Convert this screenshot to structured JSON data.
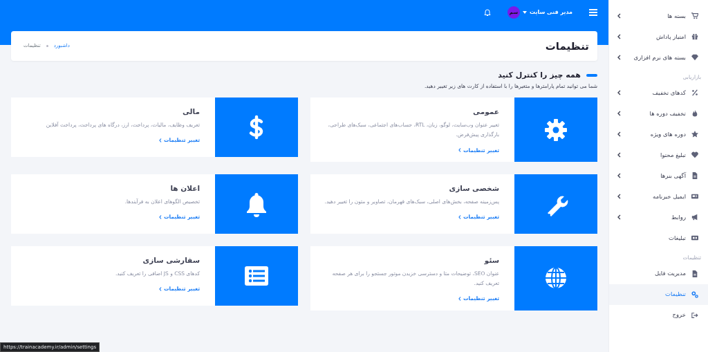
{
  "sidebar": {
    "items": [
      {
        "kind": "item",
        "label": "بسته ها",
        "has_children": true,
        "selected": false
      },
      {
        "kind": "item",
        "label": "امتیاز پاداش",
        "has_children": true,
        "selected": false
      },
      {
        "kind": "item",
        "label": "بسته های نرم افزاری",
        "has_children": true,
        "selected": false
      },
      {
        "kind": "section",
        "label": "بازاریابی"
      },
      {
        "kind": "item",
        "label": "کدهای تخفیف",
        "has_children": true,
        "selected": false
      },
      {
        "kind": "item",
        "label": "تخفیف دوره ها",
        "has_children": true,
        "selected": false
      },
      {
        "kind": "item",
        "label": "دوره های ویژه",
        "has_children": true,
        "selected": false
      },
      {
        "kind": "item",
        "label": "تبلیغ محتوا",
        "has_children": true,
        "selected": false
      },
      {
        "kind": "item",
        "label": "آگهی بنرها",
        "has_children": true,
        "selected": false
      },
      {
        "kind": "item",
        "label": "ایمیل خبرنامه",
        "has_children": true,
        "selected": false
      },
      {
        "kind": "item",
        "label": "روابط",
        "has_children": true,
        "selected": false
      },
      {
        "kind": "item",
        "label": "تبلیغات",
        "has_children": false,
        "selected": false
      },
      {
        "kind": "section",
        "label": "تنظیمات"
      },
      {
        "kind": "item",
        "label": "مدیریت فایل",
        "has_children": false,
        "selected": false
      },
      {
        "kind": "item",
        "label": "تنظیمات",
        "has_children": false,
        "selected": true
      },
      {
        "kind": "item",
        "label": "خروج",
        "has_children": false,
        "selected": false
      }
    ]
  },
  "topbar": {
    "user_name": "مدیر فنی سایت",
    "avatar_text": "سم"
  },
  "page_header": {
    "title": "تنظیمات",
    "breadcrumb": [
      {
        "label": "داشبورد",
        "link": true
      },
      {
        "label": "تنظیمات",
        "link": false
      }
    ]
  },
  "section": {
    "title": "همه چیز را کنترل کنید",
    "description": "شما می توانید تمام پارامترها و متغیرها را با استفاده از کارت های زیر تغییر دهید."
  },
  "cards": [
    {
      "title": "عمومی",
      "description": "تغییر عنوان وب‌سایت، لوگو، زبان، RTL، حساب‌های اجتماعی، سبک‌های طراحی، بارگذاری پیش‌فرض.",
      "link": "تغییر تنظیمات"
    },
    {
      "title": "مالی",
      "description": "تعریف وظایف، مالیات، پرداخت، ارز، درگاه های پرداخت، پرداخت آفلاین",
      "link": "تغییر تنظیمات"
    },
    {
      "title": "شخصی سازی",
      "description": "پس‌زمینه صفحه، بخش‌های اصلی، سبک‌های قهرمان، تصاویر و متون را تغییر دهید.",
      "link": "تغییر تنظیمات"
    },
    {
      "title": "اعلان ها",
      "description": "تخصیص الگوهای اعلان به فرآیندها.",
      "link": "تغییر تنظیمات"
    },
    {
      "title": "سئو",
      "description": "عنوان SEO، توضیحات متا و دسترسی خزیدن موتور جستجو را برای هر صفحه تعریف کنید.",
      "link": "تغییر تنظیمات"
    },
    {
      "title": "سفارشی سازی",
      "description": "کدهای CSS و JS اضافی را تعریف کنید.",
      "link": "تغییر تنظیمات"
    }
  ],
  "status_tooltip": "https://trainacademy.ir/admin/settings"
}
